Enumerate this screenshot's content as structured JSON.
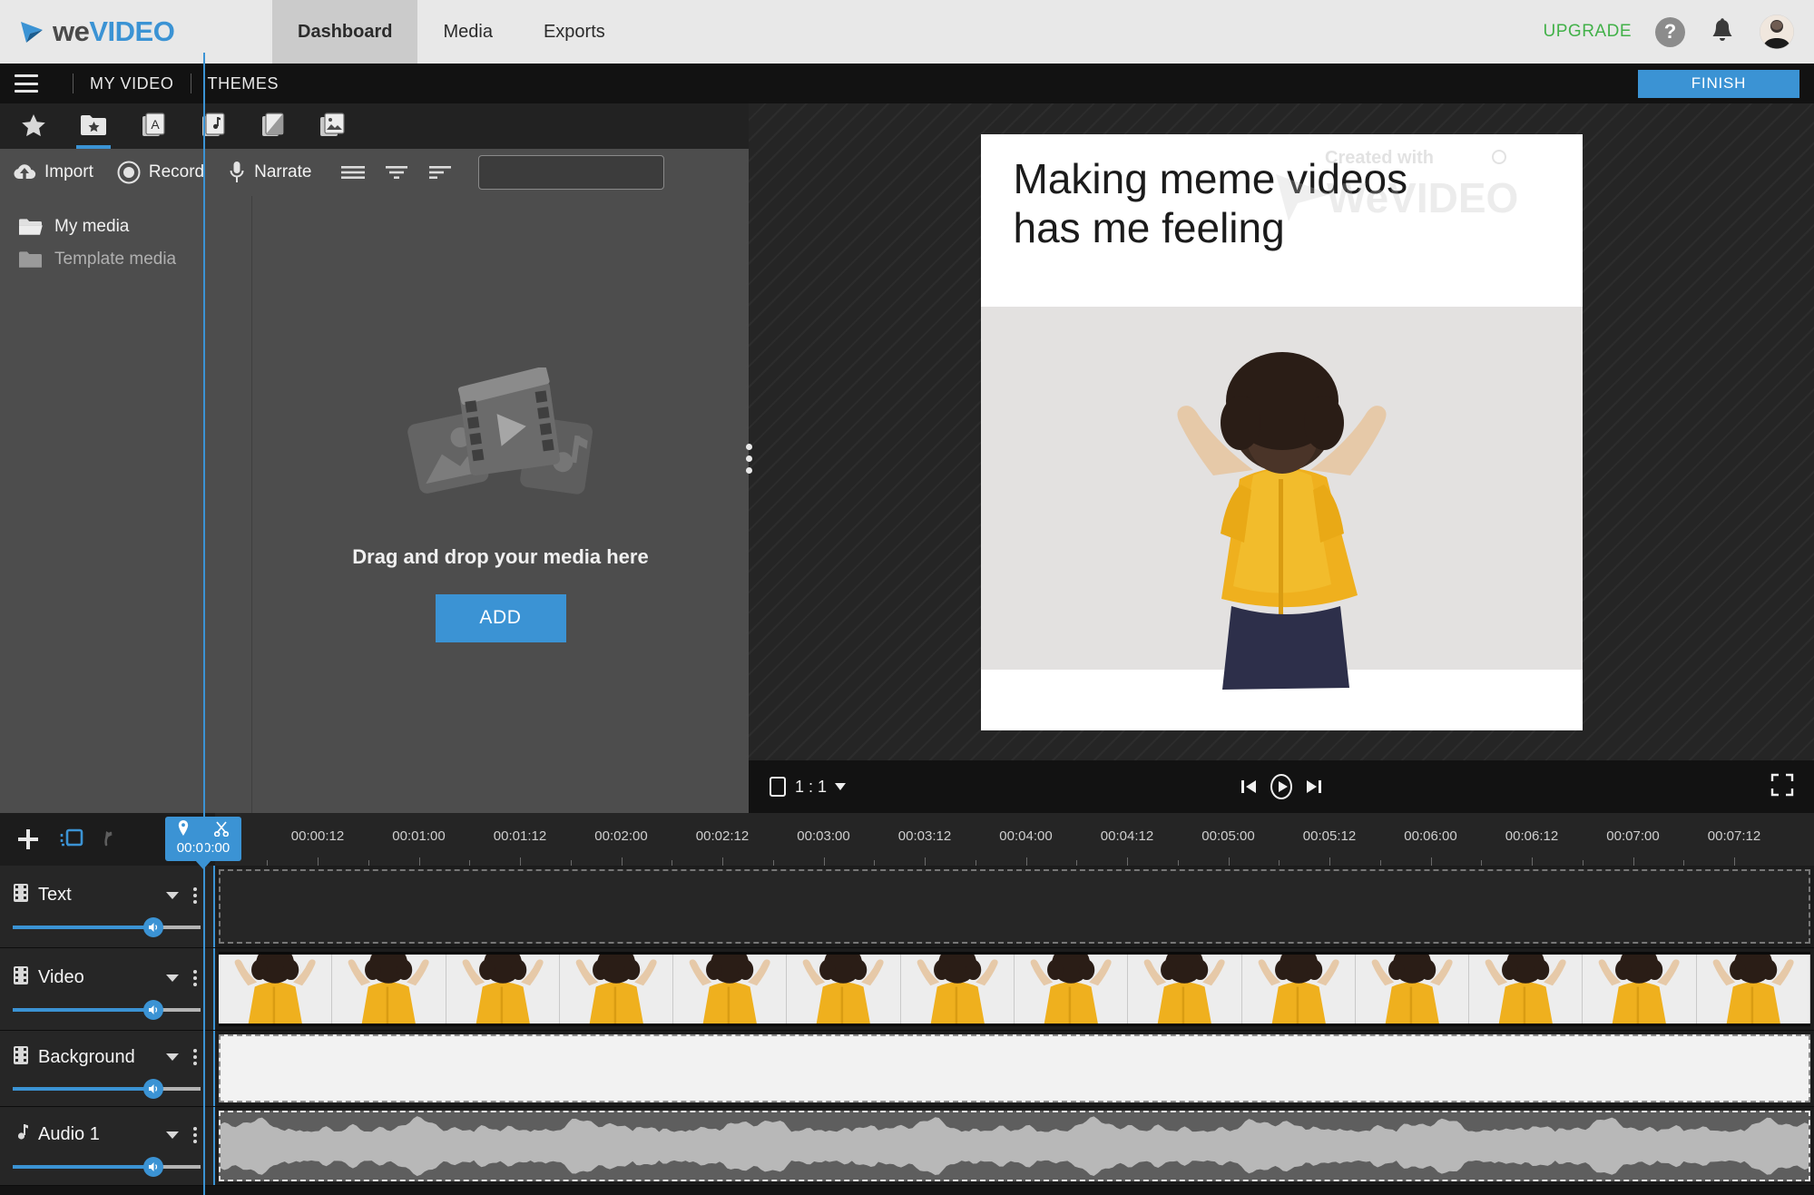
{
  "app": {
    "brand_we": "we",
    "brand_video": "VIDEO",
    "accent_blue": "#3b93d4",
    "upgrade_green": "#42b149"
  },
  "topbar": {
    "nav": [
      {
        "label": "Dashboard",
        "active": true
      },
      {
        "label": "Media",
        "active": false
      },
      {
        "label": "Exports",
        "active": false
      }
    ],
    "upgrade_label": "UPGRADE",
    "help_glyph": "?",
    "icons": {
      "help": "help-icon",
      "bell": "notifications-bell-icon",
      "avatar": "user-avatar"
    }
  },
  "projectbar": {
    "menu_icon": "hamburger-menu-icon",
    "project_name": "MY VIDEO",
    "themes_label": "THEMES",
    "finish_label": "FINISH"
  },
  "media_panel": {
    "tabs": [
      {
        "name": "favorites-tab",
        "icon": "star-icon",
        "active": false
      },
      {
        "name": "my-media-tab",
        "icon": "folder-star-icon",
        "active": true
      },
      {
        "name": "text-tab",
        "icon": "text-card-icon",
        "active": false
      },
      {
        "name": "audio-tab",
        "icon": "music-card-icon",
        "active": false
      },
      {
        "name": "transitions-tab",
        "icon": "transition-card-icon",
        "active": false
      },
      {
        "name": "graphics-tab",
        "icon": "image-stack-icon",
        "active": false
      }
    ],
    "actions": [
      {
        "label": "Import",
        "icon": "cloud-upload-icon"
      },
      {
        "label": "Record",
        "icon": "record-circle-icon"
      },
      {
        "label": "Narrate",
        "icon": "microphone-icon"
      }
    ],
    "view_icons": [
      {
        "name": "list-view-icon"
      },
      {
        "name": "filter-icon"
      },
      {
        "name": "sort-icon"
      }
    ],
    "search": {
      "value": "",
      "placeholder": ""
    },
    "folders": [
      {
        "label": "My media",
        "icon": "folder-open-icon",
        "selected": true
      },
      {
        "label": "Template media",
        "icon": "folder-closed-icon",
        "selected": false
      }
    ],
    "dropzone": {
      "message": "Drag and drop your media here",
      "add_label": "ADD"
    }
  },
  "preview": {
    "canvas_text_line1": "Making meme videos",
    "canvas_text_line2": "has me feeling",
    "watermark_small": "Created with",
    "watermark_brand": "WEVIDEO",
    "aspect_ratio": "1 : 1",
    "controls": {
      "prev": "skip-previous-icon",
      "play": "play-icon",
      "next": "skip-next-icon",
      "fullscreen": "fullscreen-icon",
      "ratio_icon": "aspect-ratio-icon"
    }
  },
  "timeline": {
    "tools": [
      {
        "name": "add-track-button",
        "icon": "plus-icon"
      },
      {
        "name": "duplicate-selection-button",
        "icon": "marquee-select-icon"
      },
      {
        "name": "undo-button",
        "icon": "undo-arrow-icon"
      }
    ],
    "playhead": {
      "timecode": "00:00:00",
      "marker_icon": "location-pin-icon",
      "cut_icon": "scissors-icon"
    },
    "ruler_labels": [
      "00:00:12",
      "00:01:00",
      "00:01:12",
      "00:02:00",
      "00:02:12",
      "00:03:00",
      "00:03:12",
      "00:04:00",
      "00:04:12",
      "00:05:00",
      "00:05:12",
      "00:06:00",
      "00:06:12",
      "00:07:00",
      "00:07:12"
    ],
    "tracks": [
      {
        "name": "Text",
        "icon": "film-strip-icon",
        "volume": 75,
        "clip": "text"
      },
      {
        "name": "Video",
        "icon": "film-strip-icon",
        "volume": 75,
        "clip": "video"
      },
      {
        "name": "Background",
        "icon": "film-strip-icon",
        "volume": 75,
        "clip": "background"
      },
      {
        "name": "Audio 1",
        "icon": "music-note-icon",
        "volume": 75,
        "clip": "audio"
      }
    ]
  }
}
